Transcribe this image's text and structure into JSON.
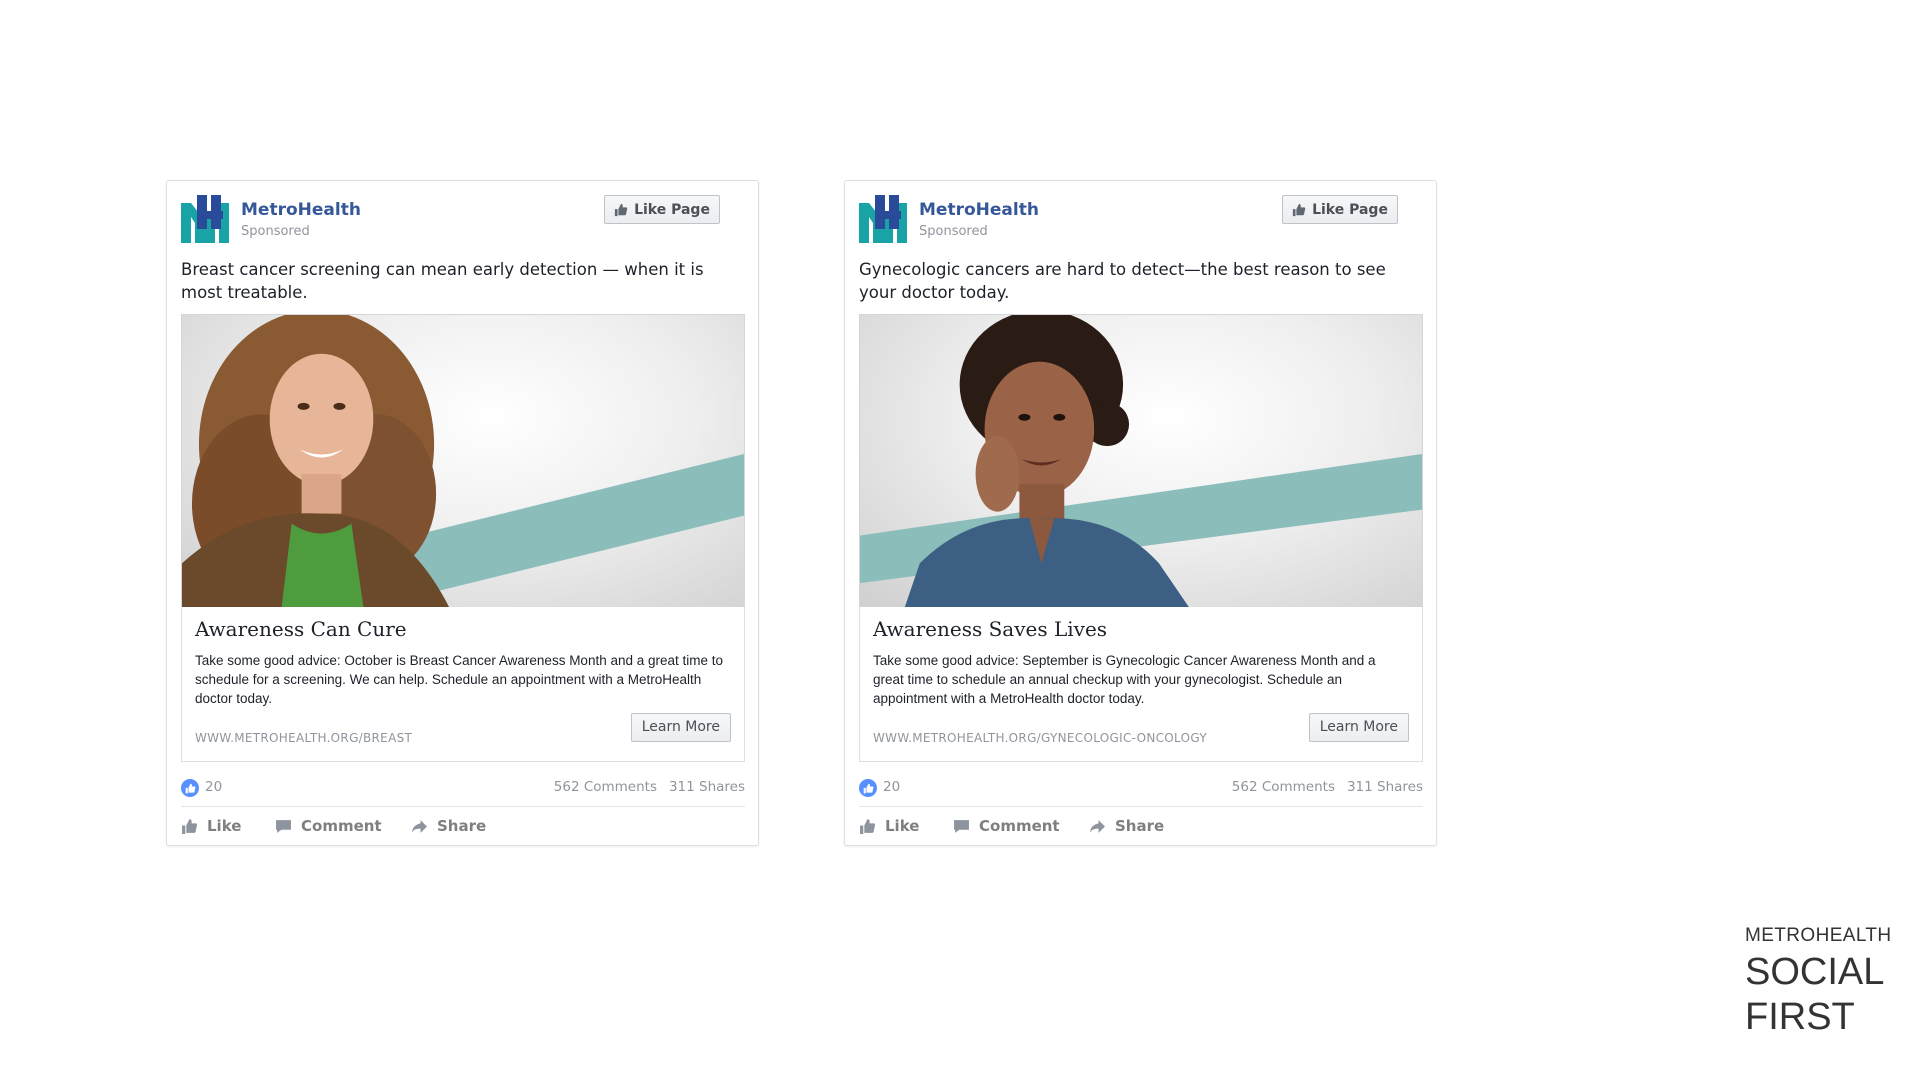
{
  "brand_colors": {
    "teal": "#1aa3a6",
    "navy": "#2a4a9a",
    "link": "#365899",
    "accent_band": "#8bbdbb"
  },
  "posts": [
    {
      "page_name": "MetroHealth",
      "sponsored_label": "Sponsored",
      "like_page_label": "Like Page",
      "post_text": "Breast cancer screening can mean early detection — when it is most treatable.",
      "image_subject": "smiling woman with curly hair in a green top and brown jacket",
      "headline": "Awareness Can Cure",
      "description": "Take some good advice: October is Breast Cancer Awareness Month and a great time to schedule for a screening. We can help. Schedule an appointment with a MetroHealth doctor today.",
      "display_url": "WWW.METROHEALTH.ORG/BREAST",
      "cta_label": "Learn More",
      "reaction_count": "20",
      "comments_label": "562 Comments",
      "shares_label": "311 Shares",
      "actions": {
        "like": "Like",
        "comment": "Comment",
        "share": "Share"
      }
    },
    {
      "page_name": "MetroHealth",
      "sponsored_label": "Sponsored",
      "like_page_label": "Like Page",
      "post_text": "Gynecologic cancers are hard to detect—the best reason to see your doctor today.",
      "image_subject": "smiling woman with hand on cheek wearing a denim shirt",
      "headline": "Awareness Saves Lives",
      "description": "Take some good advice: September is Gynecologic Cancer Awareness Month and a great time to schedule an annual checkup with your gynecologist. Schedule an appointment with a MetroHealth doctor today.",
      "display_url": "WWW.METROHEALTH.ORG/GYNECOLOGIC-ONCOLOGY",
      "cta_label": "Learn More",
      "reaction_count": "20",
      "comments_label": "562 Comments",
      "shares_label": "311 Shares",
      "actions": {
        "like": "Like",
        "comment": "Comment",
        "share": "Share"
      }
    }
  ],
  "footer_brand": {
    "line1": "METROHEALTH",
    "line2": "SOCIAL",
    "line3": "FIRST"
  }
}
